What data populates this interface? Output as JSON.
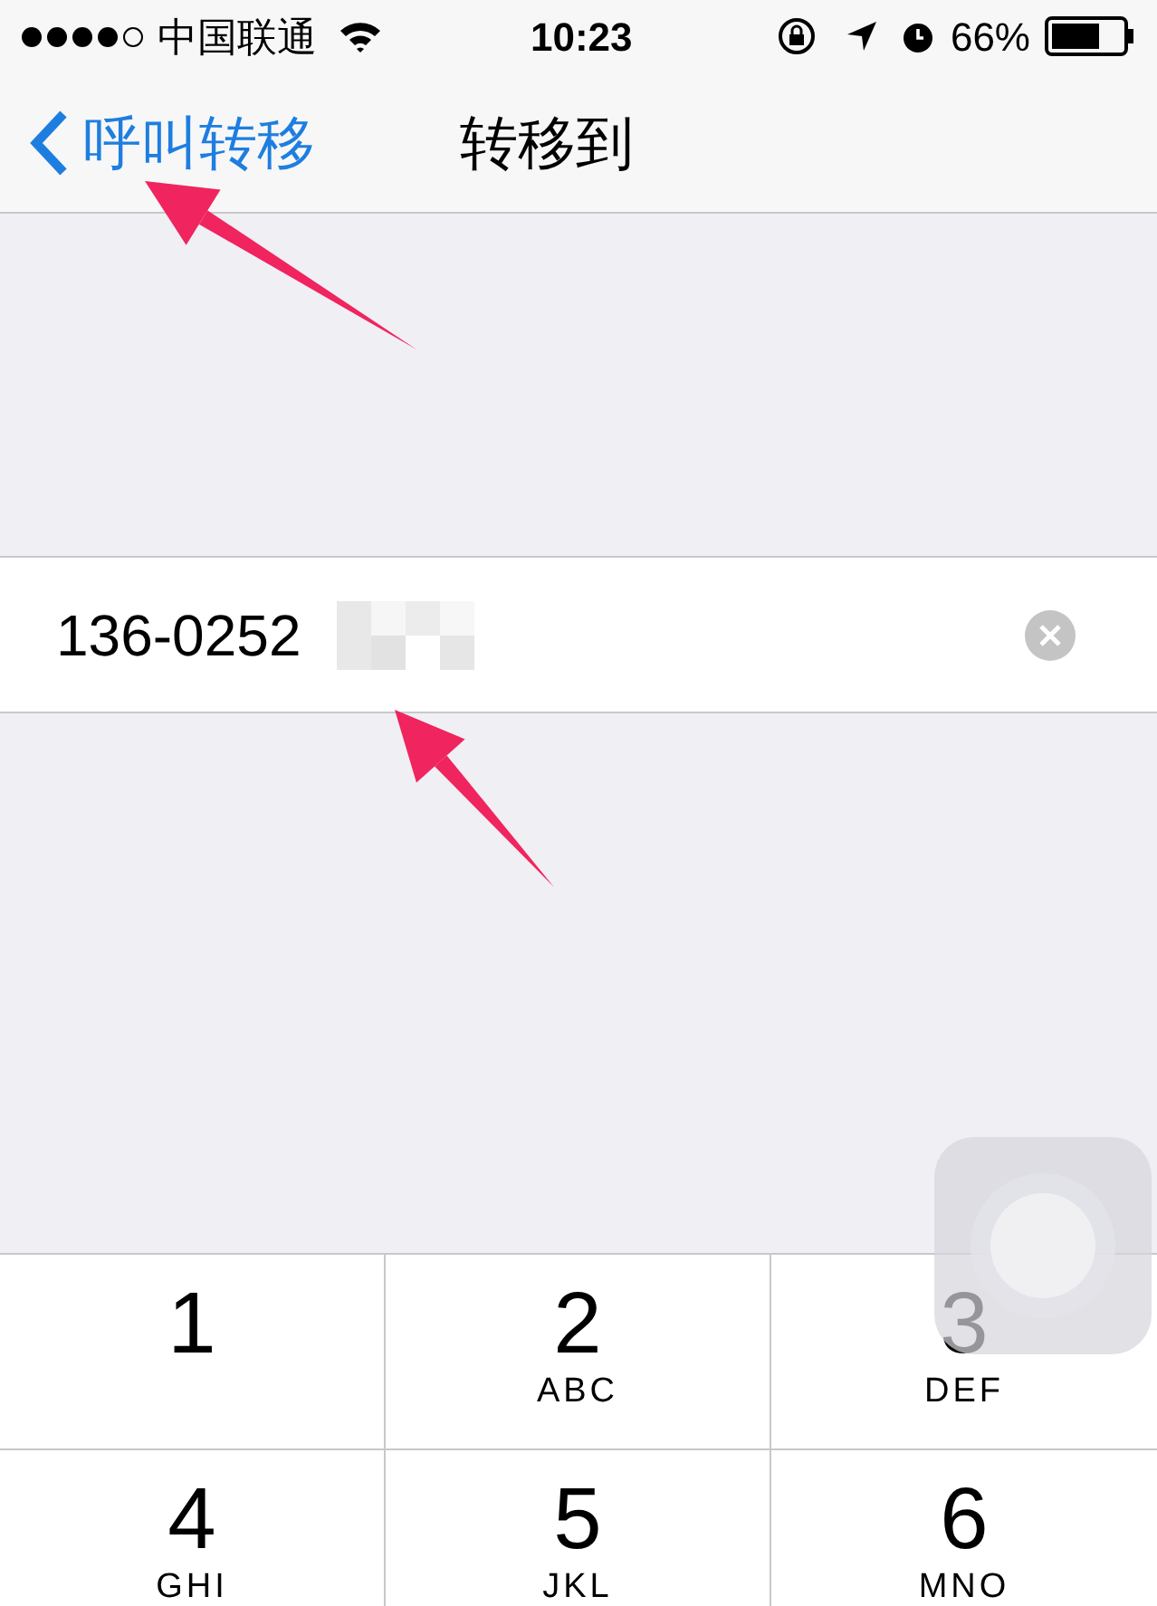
{
  "status_bar": {
    "carrier": "中国联通",
    "time": "10:23",
    "battery": "66%"
  },
  "nav_bar": {
    "back_label": "呼叫转移",
    "title": "转移到"
  },
  "phone_field": {
    "value": "136-0252"
  },
  "keypad": [
    {
      "digit": "1"
    },
    {
      "digit": "2",
      "letters": "ABC"
    },
    {
      "digit": "3",
      "letters": "DEF"
    },
    {
      "digit": "4",
      "letters": "GHI"
    },
    {
      "digit": "5",
      "letters": "JKL"
    },
    {
      "digit": "6",
      "letters": "MNO"
    }
  ]
}
